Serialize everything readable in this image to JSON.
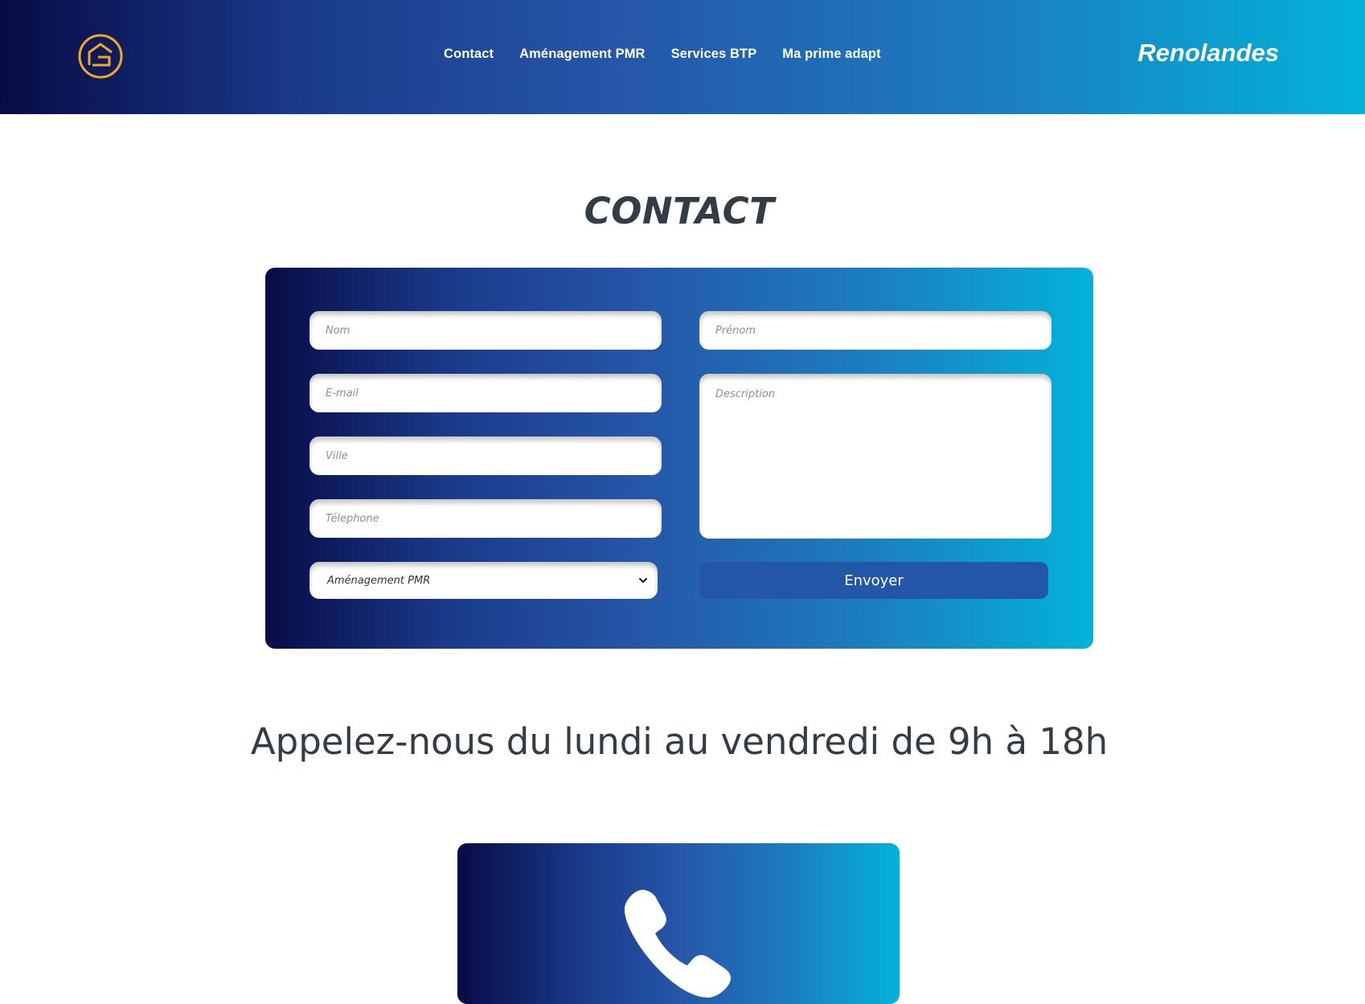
{
  "header": {
    "logo_icon": "house-logo-icon",
    "nav": [
      {
        "label": "Contact"
      },
      {
        "label": "Aménagement PMR"
      },
      {
        "label": "Services BTP"
      },
      {
        "label": "Ma prime adapt"
      }
    ],
    "brand": "Renolandes",
    "gradient": [
      "#080b46",
      "#2656a8",
      "#03b3d8"
    ]
  },
  "page_title": "CONTACT",
  "form": {
    "nom_placeholder": "Nom",
    "prenom_placeholder": "Prénom",
    "email_placeholder": "E-mail",
    "description_placeholder": "Description",
    "ville_placeholder": "Ville",
    "telephone_placeholder": "Télephone",
    "service_select": {
      "selected": "Aménagement PMR",
      "chevron_icon": "chevron-down-icon"
    },
    "submit_label": "Envoyer",
    "submit_color": "#2456a8"
  },
  "call_section": {
    "title": "Appelez-nous du lundi au vendredi de 9h à 18h",
    "icon": "phone-icon"
  }
}
